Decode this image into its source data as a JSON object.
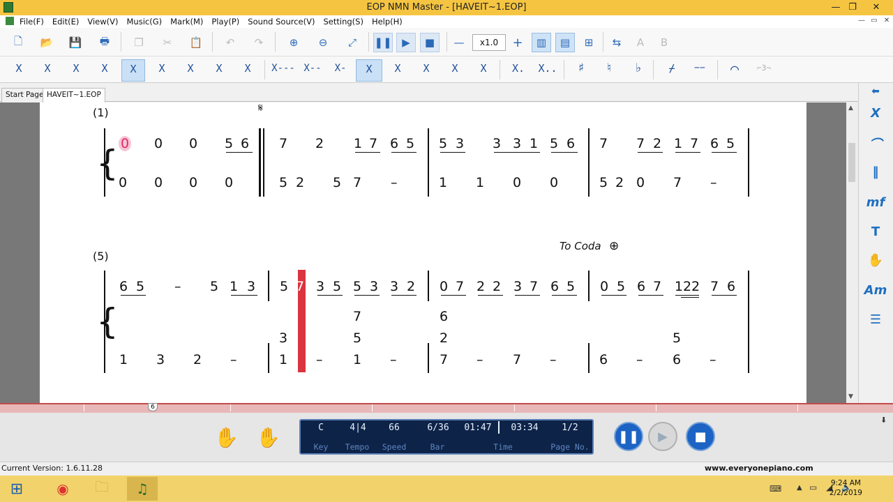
{
  "window": {
    "title": "EOP NMN Master - [HAVEIT~1.EOP]",
    "min": "—",
    "max": "❐",
    "close": "✕"
  },
  "menu": [
    "File(F)",
    "Edit(E)",
    "View(V)",
    "Music(G)",
    "Mark(M)",
    "Play(P)",
    "Sound Source(V)",
    "Setting(S)",
    "Help(H)"
  ],
  "mdi": {
    "min": "—",
    "restore": "▭",
    "close": "✕"
  },
  "toolbar": {
    "speed": "x1.0",
    "minus": "—",
    "plus": "+"
  },
  "toolbar2": {
    "notes": [
      "X",
      "X",
      "X",
      "X",
      "X",
      "X",
      "X",
      "X",
      "X",
      "X---",
      "X--",
      "X-",
      "X",
      "X",
      "X",
      "X",
      "X",
      "X.",
      "X..",
      "♯",
      "♮",
      "♭",
      "⌿",
      "−−",
      "⌒",
      "⌐3¬"
    ]
  },
  "tabs": {
    "start": "Start Page",
    "file": "HAVEIT~1.EOP"
  },
  "right_panel": [
    "X",
    "⌒",
    "‖",
    "mf",
    "T",
    "✋",
    "Am",
    "☰"
  ],
  "score": {
    "m1": "(1)",
    "m5": "(5)",
    "segno": "𝄋",
    "coda": "To Coda",
    "coda_sym": "⊕",
    "r1_top": [
      "0",
      "0",
      "0",
      "5",
      "6",
      "7",
      "2",
      "1",
      "7",
      "6",
      "5",
      "5",
      "3",
      "3",
      "3",
      "1",
      "5",
      "6",
      "7",
      "7",
      "2",
      "1",
      "7",
      "6",
      "5"
    ],
    "r1_bot": [
      "0",
      "0",
      "0",
      "0",
      "5",
      "2",
      "5",
      "7",
      "–",
      "1",
      "1",
      "0",
      "0",
      "5",
      "2",
      "0",
      "7",
      "–"
    ],
    "r2_top": [
      "6",
      "5",
      "–",
      "5",
      "1",
      "3",
      "5",
      "7",
      "3",
      "5",
      "5",
      "3",
      "3",
      "2",
      "0",
      "7",
      "2",
      "2",
      "3",
      "7",
      "6",
      "5",
      "0",
      "5",
      "6",
      "7",
      "122",
      "7",
      "6"
    ],
    "r2_mid": [
      "7",
      "6"
    ],
    "r2_chord": [
      "3",
      "5",
      "2",
      "5"
    ],
    "r2_bot": [
      "1",
      "3",
      "2",
      "–",
      "1",
      "–",
      "1",
      "–",
      "7",
      "–",
      "7",
      "–",
      "6",
      "–",
      "6",
      "–"
    ]
  },
  "timeline": {
    "marker": "6"
  },
  "display": {
    "key": "C",
    "tempo": "4|4",
    "speed": "66",
    "bar": "6/36",
    "time": "01:47",
    "total": "03:34",
    "page": "1/2",
    "labels": {
      "key": "Key",
      "tempo": "Tempo",
      "speed": "Speed",
      "bar": "Bar",
      "time": "Time",
      "page": "Page No."
    }
  },
  "status": {
    "version": "Current Version: 1.6.11.28",
    "site": "www.everyonepiano.com"
  },
  "clock": {
    "time": "9:24 AM",
    "date": "2/2/2019"
  }
}
